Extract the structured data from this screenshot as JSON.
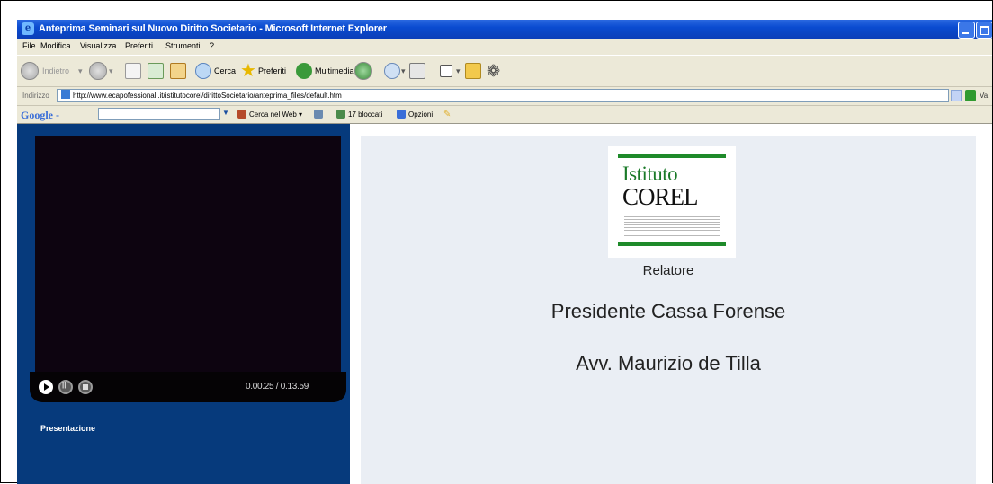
{
  "window": {
    "title": "Anteprima Seminari sul Nuovo Diritto Societario - Microsoft Internet Explorer"
  },
  "menubar": {
    "items": [
      "File",
      "Modifica",
      "Visualizza",
      "Preferiti",
      "Strumenti",
      "?"
    ]
  },
  "toolbar": {
    "back_label": "Indietro",
    "search_label": "Cerca",
    "favorites_label": "Preferiti",
    "multimedia_label": "Multimedia"
  },
  "addressbar": {
    "label": "Indirizzo",
    "url": "http://www.ecapofessionali.it/istitutocorel/dirittoSocietario/anteprima_files/default.htm",
    "go_label": "Va"
  },
  "googlebar": {
    "logo": "Google -",
    "search_web_label": "Cerca nel Web",
    "blocked_label": "17 bloccati",
    "options_label": "Opzioni"
  },
  "player": {
    "time": "0.00.25 / 0.13.59",
    "presentation_label": "Presentazione"
  },
  "slide": {
    "logo_line1": "Istituto",
    "logo_line2": "COREL",
    "relatore_label": "Relatore",
    "line1": "Presidente Cassa Forense",
    "line2": "Avv. Maurizio de Tilla"
  }
}
